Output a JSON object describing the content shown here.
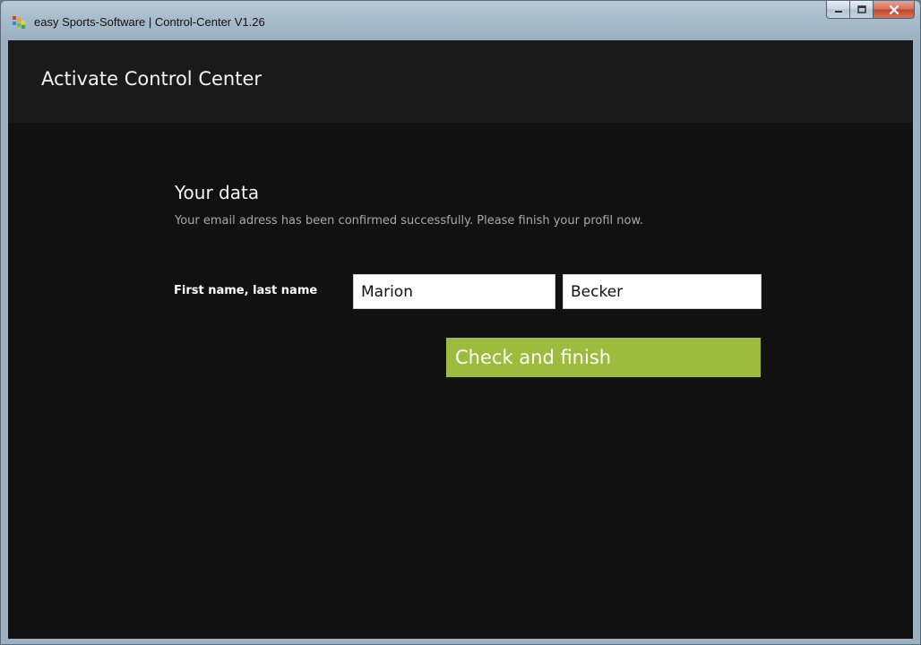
{
  "window": {
    "title": "easy Sports-Software | Control-Center V1.26",
    "icon": "app-logo-icon",
    "controls": {
      "minimize_icon": "minimize-icon",
      "maximize_icon": "maximize-icon",
      "close_icon": "close-icon"
    }
  },
  "header": {
    "title": "Activate Control Center"
  },
  "form": {
    "section_title": "Your data",
    "section_subtitle": "Your email adress has been confirmed successfully. Please finish your profil now.",
    "name_label": "First name, last name",
    "first_name_value": "Marion",
    "last_name_value": "Becker",
    "submit_label": "Check and finish"
  },
  "colors": {
    "accent": "#9dbb3d",
    "background": "#111111",
    "header_band": "#1a1a1a"
  }
}
